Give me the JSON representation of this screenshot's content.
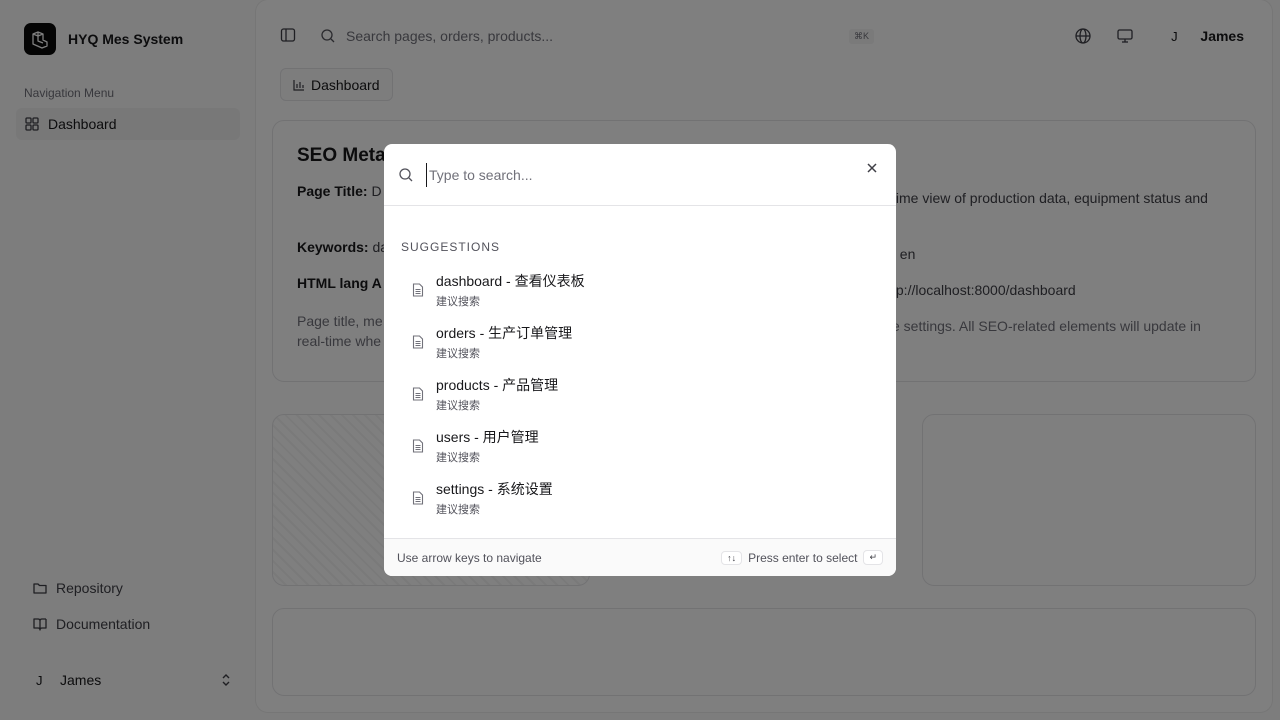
{
  "app": {
    "name": "HYQ Mes System"
  },
  "sidebar": {
    "group_label": "Navigation Menu",
    "items": [
      {
        "label": "Dashboard",
        "icon": "layout-grid-icon"
      }
    ],
    "footer_items": [
      {
        "label": "Repository",
        "icon": "folder-icon"
      },
      {
        "label": "Documentation",
        "icon": "book-icon"
      }
    ],
    "user": {
      "initial": "J",
      "name": "James"
    }
  },
  "header": {
    "search_placeholder": "Search pages, orders, products...",
    "shortcut": "⌘K",
    "user": {
      "initial": "J",
      "name": "James"
    }
  },
  "breadcrumb": {
    "label": "Dashboard"
  },
  "seo_card": {
    "title": "SEO Meta",
    "page_title_label": "Page Title:",
    "page_title_value": "D",
    "description_tail": "time view of production data, equipment status and",
    "keywords_label": "Keywords:",
    "keywords_value": "da",
    "lang_tail": ": en",
    "html_lang_label": "HTML lang A",
    "url_tail": "tp://localhost:8000/dashboard",
    "note_start": "Page title, me",
    "note_tail": "e settings. All SEO-related elements will update in",
    "note_line2": "real-time whe"
  },
  "dialog": {
    "search_placeholder": "Type to search...",
    "suggestions_label": "SUGGESTIONS",
    "suggestions": [
      {
        "title": "dashboard - 查看仪表板",
        "subtitle": "建议搜索"
      },
      {
        "title": "orders - 生产订单管理",
        "subtitle": "建议搜索"
      },
      {
        "title": "products - 产品管理",
        "subtitle": "建议搜索"
      },
      {
        "title": "users - 用户管理",
        "subtitle": "建议搜索"
      },
      {
        "title": "settings - 系统设置",
        "subtitle": "建议搜索"
      }
    ],
    "footer_hint": "Use arrow keys to navigate",
    "nav_key": "↑↓",
    "enter_hint": "Press enter to select",
    "enter_key": "↵"
  }
}
